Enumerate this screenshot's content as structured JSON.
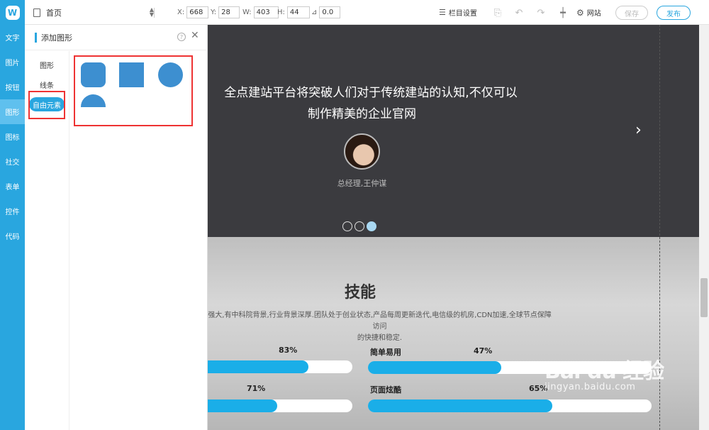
{
  "rail": {
    "logo": "W",
    "items": [
      {
        "label": "文字"
      },
      {
        "label": "图片"
      },
      {
        "label": "按钮"
      },
      {
        "label": "图形",
        "active": true
      },
      {
        "label": "图标"
      },
      {
        "label": "社交"
      },
      {
        "label": "表单"
      },
      {
        "label": "控件"
      },
      {
        "label": "代码"
      }
    ]
  },
  "toolbar": {
    "page_select": "首页",
    "geometry": {
      "x_label": "X:",
      "x": "668",
      "y_label": "Y:",
      "y": "28",
      "w_label": "W:",
      "w": "403",
      "h_label": "H:",
      "h": "44",
      "angle": "0.0"
    },
    "column_settings": "栏目设置",
    "site": "网站",
    "save": "保存",
    "publish": "发布"
  },
  "panel": {
    "title": "添加图形",
    "help": "?",
    "categories": [
      {
        "label": "图形"
      },
      {
        "label": "线条"
      },
      {
        "label": "自由元素",
        "active": true
      }
    ],
    "shapes": [
      "rounded-square",
      "square",
      "circle",
      "half-circle"
    ],
    "shape_color": "#3d8fd0"
  },
  "hero": {
    "quote_line1": "全点建站平台将突破人们对于传统建站的认知,不仅可以",
    "quote_line2": "制作精美的企业官网",
    "author": "总经理,王仲谋",
    "slide_count": 3,
    "active_slide": 3
  },
  "skills": {
    "title": "技能",
    "desc_line1": "强大,有中科院背景,行业背景深厚.团队处于创业状态,产品每周更新迭代,电信级的机房,CDN加速,全球节点保障访问",
    "desc_line2": "的快捷和稳定.",
    "bars": [
      {
        "label": "",
        "percent_text": "83%",
        "value": 0.83
      },
      {
        "label": "简单易用",
        "percent_text": "47%",
        "value": 0.47
      },
      {
        "label": "",
        "percent_text": "71%",
        "value": 0.71
      },
      {
        "label": "页面炫酷",
        "percent_text": "65%",
        "value": 0.65
      }
    ]
  },
  "watermark": {
    "line1": "Bai du 经验",
    "line2": "jingyan.baidu.com"
  },
  "colors": {
    "accent": "#29a6df",
    "progress": "#1aaee8",
    "highlight": "#e33333",
    "hero_bg": "#3b3b3f"
  }
}
